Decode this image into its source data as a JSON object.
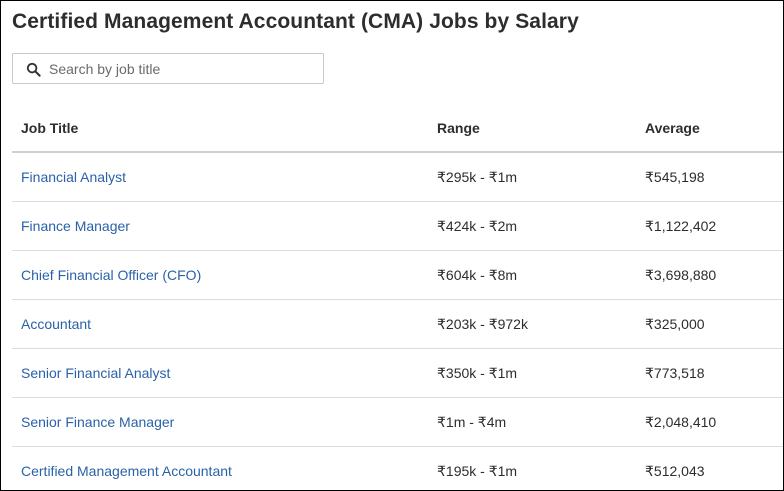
{
  "page": {
    "title": "Certified Management Accountant (CMA) Jobs by Salary"
  },
  "search": {
    "placeholder": "Search by job title",
    "icon": "search-icon"
  },
  "table": {
    "headers": [
      "Job Title",
      "Range",
      "Average"
    ],
    "rows": [
      {
        "title": "Financial Analyst",
        "range": "₹295k - ₹1m",
        "average": "₹545,198"
      },
      {
        "title": "Finance Manager",
        "range": "₹424k - ₹2m",
        "average": "₹1,122,402"
      },
      {
        "title": "Chief Financial Officer (CFO)",
        "range": "₹604k - ₹8m",
        "average": "₹3,698,880"
      },
      {
        "title": "Accountant",
        "range": "₹203k - ₹972k",
        "average": "₹325,000"
      },
      {
        "title": "Senior Financial Analyst",
        "range": "₹350k - ₹1m",
        "average": "₹773,518"
      },
      {
        "title": "Senior Finance Manager",
        "range": "₹1m - ₹4m",
        "average": "₹2,048,410"
      },
      {
        "title": "Certified Management Accountant",
        "range": "₹195k - ₹1m",
        "average": "₹512,043"
      }
    ]
  },
  "colors": {
    "link": "#2a62a8",
    "text": "#2d2d2d",
    "divider": "#dcdcdc"
  }
}
